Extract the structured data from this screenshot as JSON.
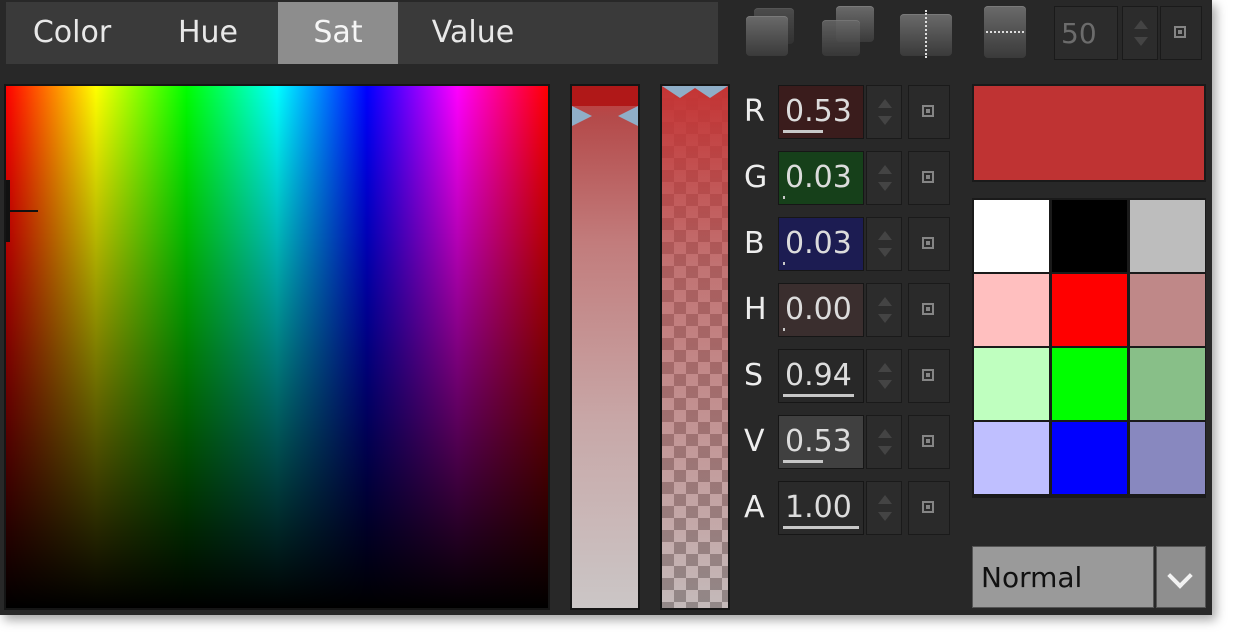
{
  "tabs": [
    {
      "label": "Color"
    },
    {
      "label": "Hue"
    },
    {
      "label": "Sat",
      "active": true
    },
    {
      "label": "Value"
    }
  ],
  "toolbar": {
    "icons": [
      "stacked-squares-icon",
      "overlap-squares-icon",
      "vertical-split-icon",
      "horizontal-split-icon"
    ],
    "number_value": "50"
  },
  "channels": [
    {
      "label": "R",
      "value": "0.53",
      "fraction": 0.53,
      "bg": "#3a1c1c"
    },
    {
      "label": "G",
      "value": "0.03",
      "fraction": 0.03,
      "bg": "#16401a"
    },
    {
      "label": "B",
      "value": "0.03",
      "fraction": 0.03,
      "bg": "#1c1c52"
    },
    {
      "label": "H",
      "value": "0.00",
      "fraction": 0.0,
      "bg": "#3a2e2e"
    },
    {
      "label": "S",
      "value": "0.94",
      "fraction": 0.94,
      "bg": "#282828"
    },
    {
      "label": "V",
      "value": "0.53",
      "fraction": 0.53,
      "bg": "#404040"
    },
    {
      "label": "A",
      "value": "1.00",
      "fraction": 1.0,
      "bg": "#2a2a2a"
    }
  ],
  "current_color": "#bf3333",
  "swatches": [
    "#ffffff",
    "#000000",
    "#bdbdbd",
    "#ffbfbf",
    "#ff0000",
    "#bf8888",
    "#bfffbf",
    "#00ff00",
    "#88bf88",
    "#bfbfff",
    "#0000ff",
    "#8888bf"
  ],
  "blend_mode": {
    "selected": "Normal"
  }
}
